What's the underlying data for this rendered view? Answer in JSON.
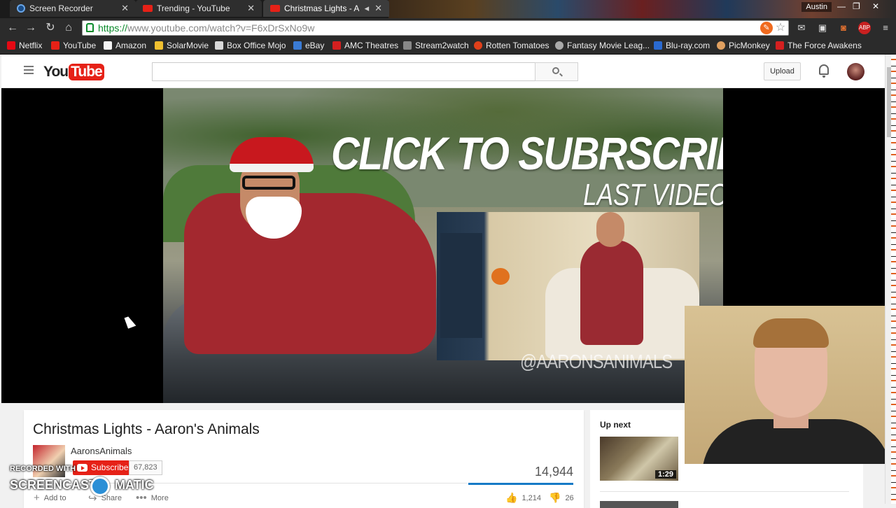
{
  "browser": {
    "tabs": [
      {
        "title": "Screen Recorder",
        "favicon": "screen-recorder-icon",
        "active": false
      },
      {
        "title": "Trending - YouTube",
        "favicon": "youtube-icon",
        "active": false
      },
      {
        "title": "Christmas Lights - Aaro",
        "favicon": "youtube-icon",
        "active": true
      }
    ],
    "profile": "Austin",
    "url_scheme": "https://",
    "url_rest": "www.youtube.com/watch?v=F6xDrSxNo9w",
    "bookmarks": [
      {
        "label": "Netflix",
        "color": "#e50914"
      },
      {
        "label": "YouTube",
        "color": "#e62117"
      },
      {
        "label": "Amazon",
        "color": "#f5f5f5"
      },
      {
        "label": "SolarMovie",
        "color": "#f0c030"
      },
      {
        "label": "Box Office Mojo",
        "color": "#d9d9d9"
      },
      {
        "label": "eBay",
        "color": "#3a7bd5"
      },
      {
        "label": "AMC Theatres",
        "color": "#d42020"
      },
      {
        "label": "Stream2watch",
        "color": "#888888"
      },
      {
        "label": "Rotten Tomatoes",
        "color": "#e0401a"
      },
      {
        "label": "Fantasy Movie Leag...",
        "color": "#aaaaaa"
      },
      {
        "label": "Blu-ray.com",
        "color": "#2a6ad0"
      },
      {
        "label": "PicMonkey",
        "color": "#e0a060"
      },
      {
        "label": "The Force Awakens",
        "color": "#d42020"
      }
    ]
  },
  "youtube": {
    "logo_you": "You",
    "logo_tube": "Tube",
    "search_placeholder": "",
    "upload_label": "Upload"
  },
  "video": {
    "overlay_headline": "CLICK TO SUBRSCRIBE",
    "overlay_subline": "LAST VIDEO",
    "watermark": "@AARONSANIMALS",
    "title": "Christmas Lights - Aaron's Animals",
    "channel": "AaronsAnimals",
    "subscribe_label": "Subscribe",
    "subscriber_count": "67,823",
    "views": "14,944",
    "likes": "1,214",
    "dislikes": "26",
    "actions": {
      "add_to": "Add to",
      "share": "Share",
      "more": "More"
    }
  },
  "sidebar": {
    "up_next_label": "Up next",
    "first_duration": "1:29"
  },
  "recorder": {
    "recorded_with": "RECORDED WITH",
    "brand_left": "SCREENCAST",
    "brand_right": "MATIC"
  },
  "colors": {
    "youtube_red": "#e62117",
    "like_bar": "#167ac6",
    "https_green": "#0a8a2a"
  }
}
